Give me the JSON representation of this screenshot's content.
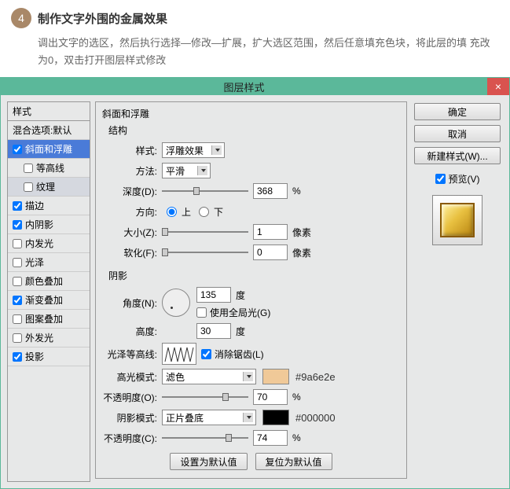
{
  "step": {
    "num": "4",
    "title": "制作文字外围的金属效果",
    "desc": "调出文字的选区，然后执行选择—修改—扩展，扩大选区范围，然后任意填充色块，将此层的填 充改为0，双击打开图层样式修改"
  },
  "dialog": {
    "title": "图层样式",
    "close": "×"
  },
  "styles": {
    "header": "样式",
    "blend": "混合选项:默认",
    "bevel": "斜面和浮雕",
    "contour": "等高线",
    "texture": "纹理",
    "stroke": "描边",
    "innerShadow": "内阴影",
    "innerGlow": "内发光",
    "satin": "光泽",
    "colorOverlay": "颜色叠加",
    "gradOverlay": "渐变叠加",
    "patternOverlay": "图案叠加",
    "outerGlow": "外发光",
    "dropShadow": "投影"
  },
  "bevel": {
    "panel": "斜面和浮雕",
    "structure": "结构",
    "styleLbl": "样式:",
    "style": "浮雕效果",
    "techLbl": "方法:",
    "tech": "平滑",
    "depthLbl": "深度(D):",
    "depth": "368",
    "pct": "%",
    "dirLbl": "方向:",
    "up": "上",
    "down": "下",
    "sizeLbl": "大小(Z):",
    "size": "1",
    "px": "像素",
    "softenLbl": "软化(F):",
    "soften": "0"
  },
  "shade": {
    "panel": "阴影",
    "angleLbl": "角度(N):",
    "angle": "135",
    "deg": "度",
    "globalLight": "使用全局光(G)",
    "altLbl": "高度:",
    "alt": "30",
    "glossLbl": "光泽等高线:",
    "antialias": "消除锯齿(L)",
    "hiLbl": "高光模式:",
    "hiMode": "滤色",
    "hiHex": "#9a6e2e",
    "hiOpLbl": "不透明度(O):",
    "hiOp": "70",
    "shLbl": "阴影模式:",
    "shMode": "正片叠底",
    "shHex": "#000000",
    "shOpLbl": "不透明度(C):",
    "shOp": "74"
  },
  "buttons": {
    "setDefault": "设置为默认值",
    "resetDefault": "复位为默认值",
    "ok": "确定",
    "cancel": "取消",
    "newStyle": "新建样式(W)...",
    "preview": "预览(V)"
  },
  "colors": {
    "hi": "#f0c998",
    "sh": "#000000"
  }
}
